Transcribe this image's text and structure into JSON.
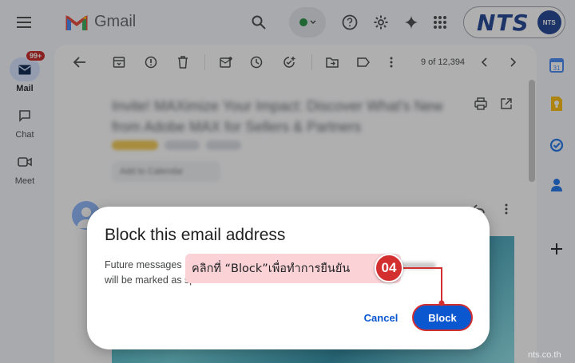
{
  "app": {
    "name": "Gmail",
    "brand_badge": "NTS",
    "brand_badge_small": "NTS",
    "colors": {
      "accent": "#0b57d0",
      "annotation": "#d32f2f",
      "callout_bg": "#fbd3d7"
    }
  },
  "sidebar": {
    "items": [
      {
        "label": "Mail",
        "badge": "99+",
        "icon": "mail-icon",
        "active": true
      },
      {
        "label": "Chat",
        "icon": "chat-icon",
        "active": false
      },
      {
        "label": "Meet",
        "icon": "video-icon",
        "active": false
      }
    ]
  },
  "toolbar": {
    "pager": "9 of 12,394"
  },
  "email": {
    "subject": "Invite! MAXimize Your Impact: Discover What's New from Adobe MAX for Sellers & Partners",
    "calendar_button": "Add to Calendar"
  },
  "dialog": {
    "title": "Block this email address",
    "body_line1": "Future messages",
    "body_line2": "will be marked as sp",
    "cancel_label": "Cancel",
    "block_label": "Block"
  },
  "annotation": {
    "text": "คลิกที่ “Block”เพื่อทำการยืนยัน",
    "step": "04"
  },
  "watermark": "nts.co.th"
}
